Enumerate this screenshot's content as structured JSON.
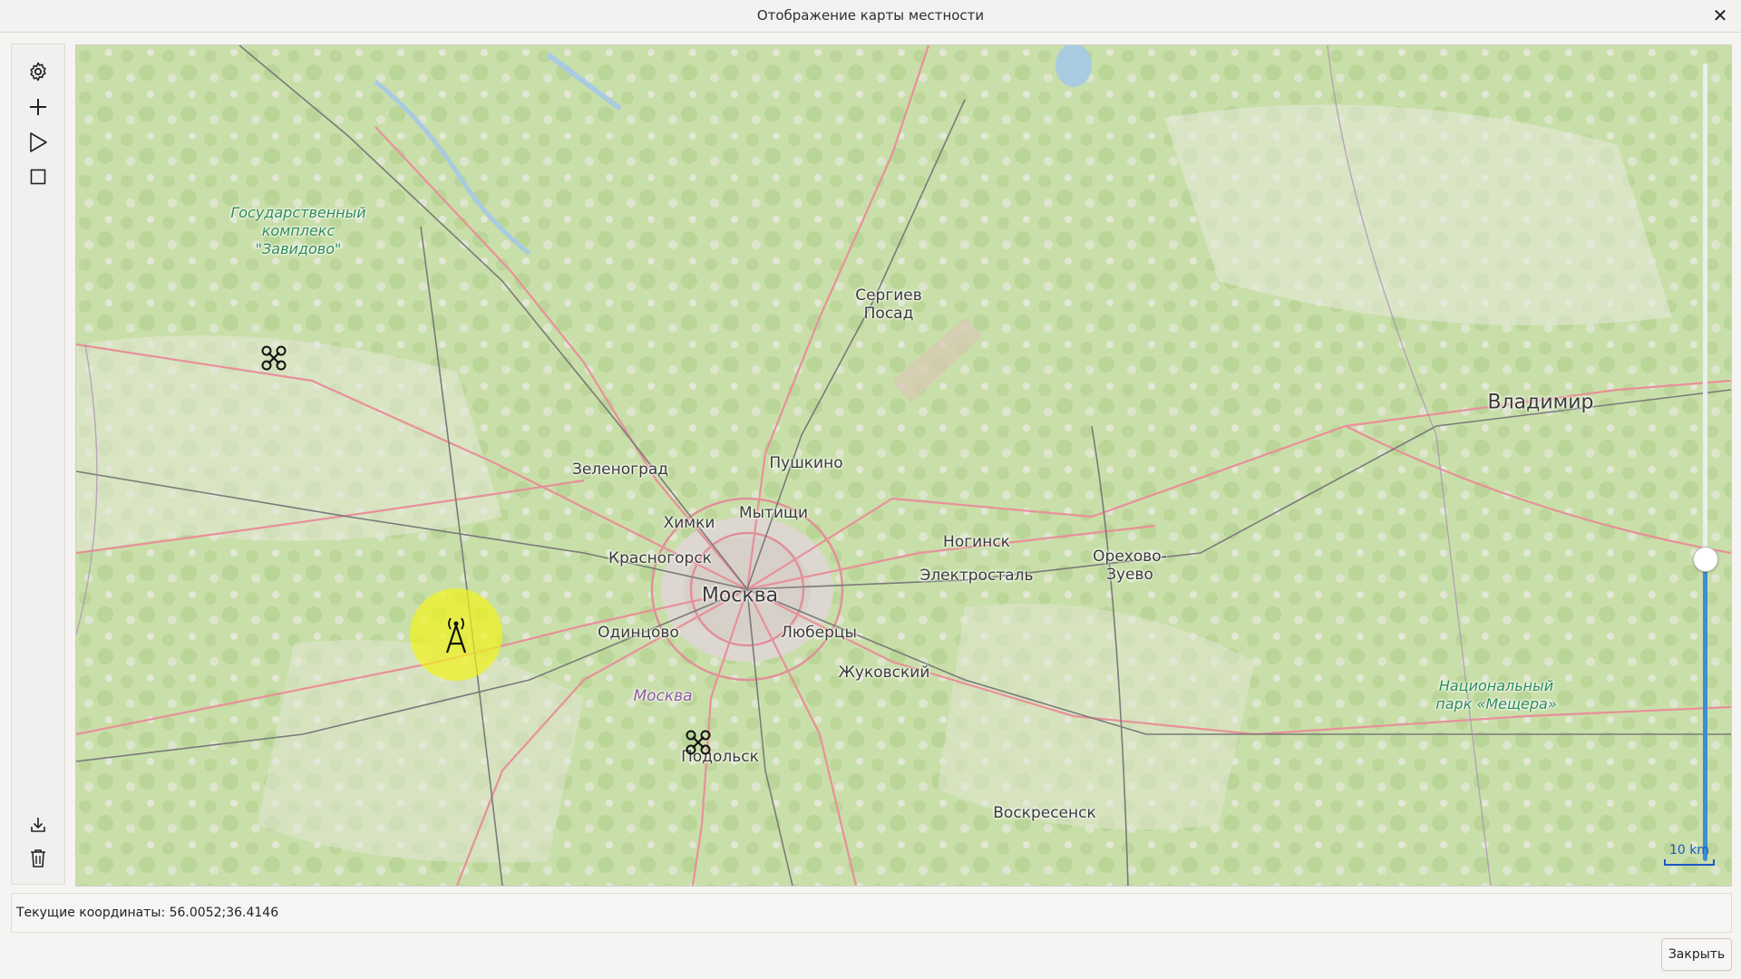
{
  "window": {
    "title": "Отображение карты местности",
    "close_glyph": "✕"
  },
  "toolbar": {
    "items": [
      {
        "icon": "gear-icon"
      },
      {
        "icon": "plus-icon"
      },
      {
        "icon": "play-icon"
      },
      {
        "icon": "stop-icon"
      },
      {
        "icon": "download-icon"
      },
      {
        "icon": "trash-icon"
      }
    ]
  },
  "map": {
    "labels": {
      "zavidovo_1": "Государственный",
      "zavidovo_2": "комплекс",
      "zavidovo_3": "\"Завидово\"",
      "sergiev_1": "Сергиев",
      "sergiev_2": "Посад",
      "vladimir": "Владимир",
      "zelenograd": "Зеленоград",
      "pushkino": "Пушкино",
      "khimki": "Химки",
      "mytishchi": "Мытищи",
      "noginsk": "Ногинск",
      "krasnogorsk": "Красногорск",
      "elektrostal": "Электросталь",
      "orekhovo_1": "Орехово-",
      "orekhovo_2": "Зуево",
      "moskva": "Москва",
      "odintsovo": "Одинцово",
      "lyubertsy": "Люберцы",
      "zhukovsky": "Жуковский",
      "moskva_river": "Москва",
      "podolsk": "Подольск",
      "voskresensk": "Воскресенск",
      "meshchera_1": "Национальный",
      "meshchera_2": "парк «Мещера»"
    },
    "markers": [
      {
        "type": "drone",
        "icon": "drone-icon"
      },
      {
        "type": "drone",
        "icon": "drone-icon"
      },
      {
        "type": "antenna",
        "icon": "antenna-icon",
        "highlight_color": "#f2f21c"
      }
    ],
    "zoom_level": 0.38,
    "scale_label": "10 km"
  },
  "status": {
    "coordinates_text": "Текущие координаты: 56.0052;36.4146"
  },
  "footer": {
    "close_label": "Закрыть"
  },
  "colors": {
    "accent": "#3b8ed0",
    "scale": "#1e56c8",
    "map_green": "#c4dea6",
    "road_major": "#e8909a",
    "road_rail": "#6c6c6c"
  }
}
